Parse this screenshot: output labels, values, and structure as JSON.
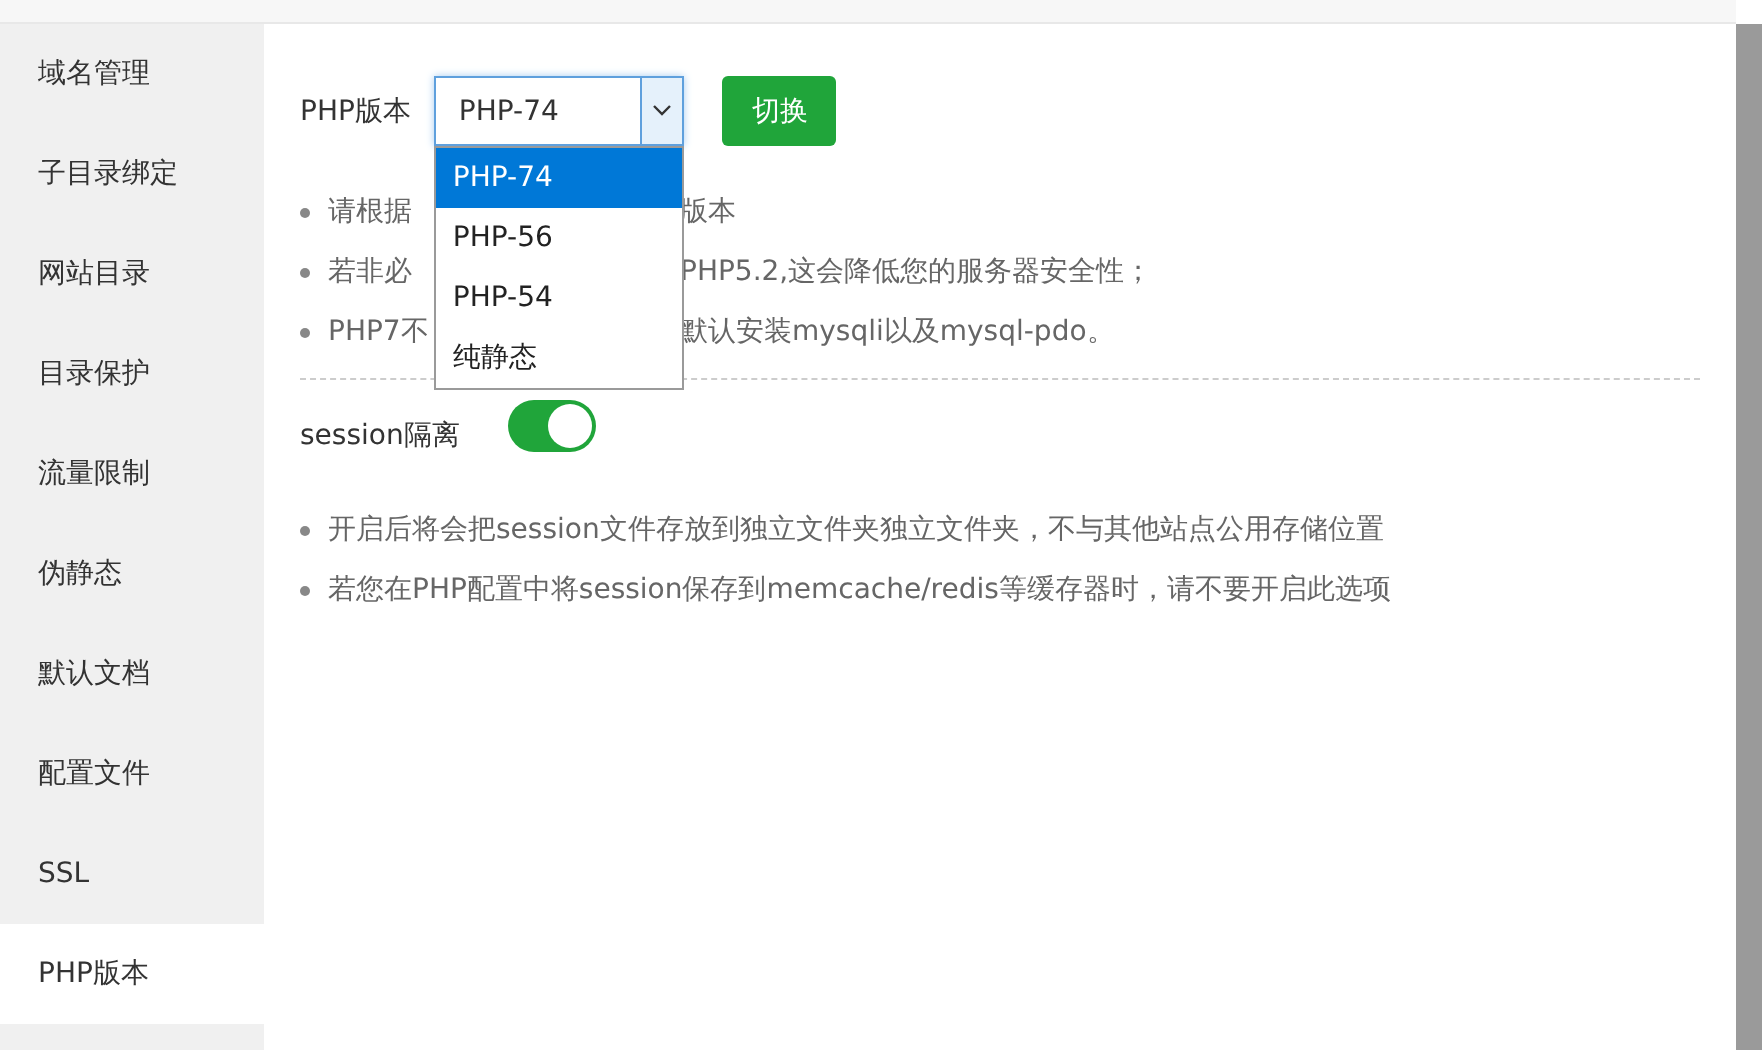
{
  "sidebar": {
    "items": [
      {
        "label": "域名管理",
        "selected": false
      },
      {
        "label": "子目录绑定",
        "selected": false
      },
      {
        "label": "网站目录",
        "selected": false
      },
      {
        "label": "目录保护",
        "selected": false
      },
      {
        "label": "流量限制",
        "selected": false
      },
      {
        "label": "伪静态",
        "selected": false
      },
      {
        "label": "默认文档",
        "selected": false
      },
      {
        "label": "配置文件",
        "selected": false
      },
      {
        "label": "SSL",
        "selected": false
      },
      {
        "label": "PHP版本",
        "selected": true
      }
    ]
  },
  "php_version": {
    "label": "PHP版本",
    "value": "PHP-74",
    "expanded": true,
    "options": [
      {
        "label": "PHP-74",
        "selected": true
      },
      {
        "label": "PHP-56",
        "selected": false
      },
      {
        "label": "PHP-54",
        "selected": false
      },
      {
        "label": "纯静态",
        "selected": false
      }
    ],
    "button": "切换"
  },
  "notes": [
    {
      "left": "请根据",
      "right": "版本"
    },
    {
      "left": "若非必",
      "right": "PHP5.2,这会降低您的服务器安全性；"
    },
    {
      "left": "PHP7不",
      "right": "默认安装mysqli以及mysql-pdo。"
    }
  ],
  "session": {
    "label": "session隔离",
    "on": true
  },
  "session_notes": [
    "开启后将会把session文件存放到独立文件夹独立文件夹，不与其他站点公用存储位置",
    "若您在PHP配置中将session保存到memcache/redis等缓存器时，请不要开启此选项"
  ]
}
